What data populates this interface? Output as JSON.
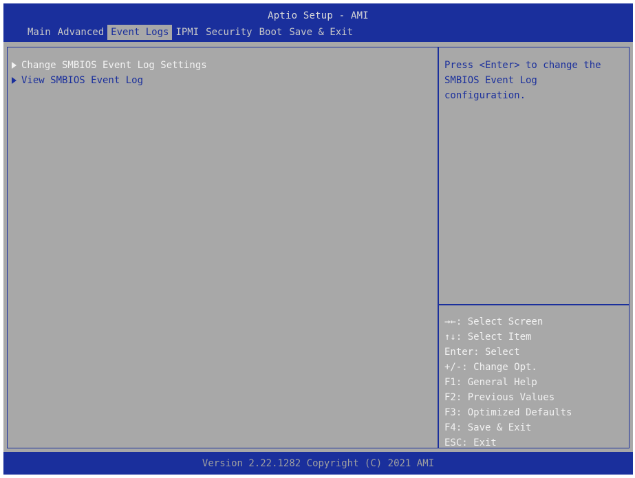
{
  "header": {
    "title": "Aptio Setup - AMI",
    "tabs": [
      {
        "label": "Main",
        "active": false
      },
      {
        "label": "Advanced",
        "active": false
      },
      {
        "label": "Event Logs",
        "active": true
      },
      {
        "label": "IPMI",
        "active": false
      },
      {
        "label": "Security",
        "active": false
      },
      {
        "label": "Boot",
        "active": false
      },
      {
        "label": "Save & Exit",
        "active": false
      }
    ]
  },
  "main": {
    "items": [
      {
        "label": "Change SMBIOS Event Log Settings",
        "selected": true
      },
      {
        "label": "View SMBIOS Event Log",
        "selected": false
      }
    ]
  },
  "help": {
    "text": "Press <Enter> to change the\nSMBIOS Event Log\nconfiguration."
  },
  "keys": [
    "→←: Select Screen",
    "↑↓: Select Item",
    "Enter: Select",
    "+/-: Change Opt.",
    "F1: General Help",
    "F2: Previous Values",
    "F3: Optimized Defaults",
    "F4: Save & Exit",
    "ESC: Exit"
  ],
  "footer": {
    "version": "Version 2.22.1282 Copyright (C) 2021 AMI"
  },
  "colors": {
    "bios_blue": "#1a2f9c",
    "panel_gray": "#a8a8a8",
    "highlight_white": "#f2f2f2"
  }
}
